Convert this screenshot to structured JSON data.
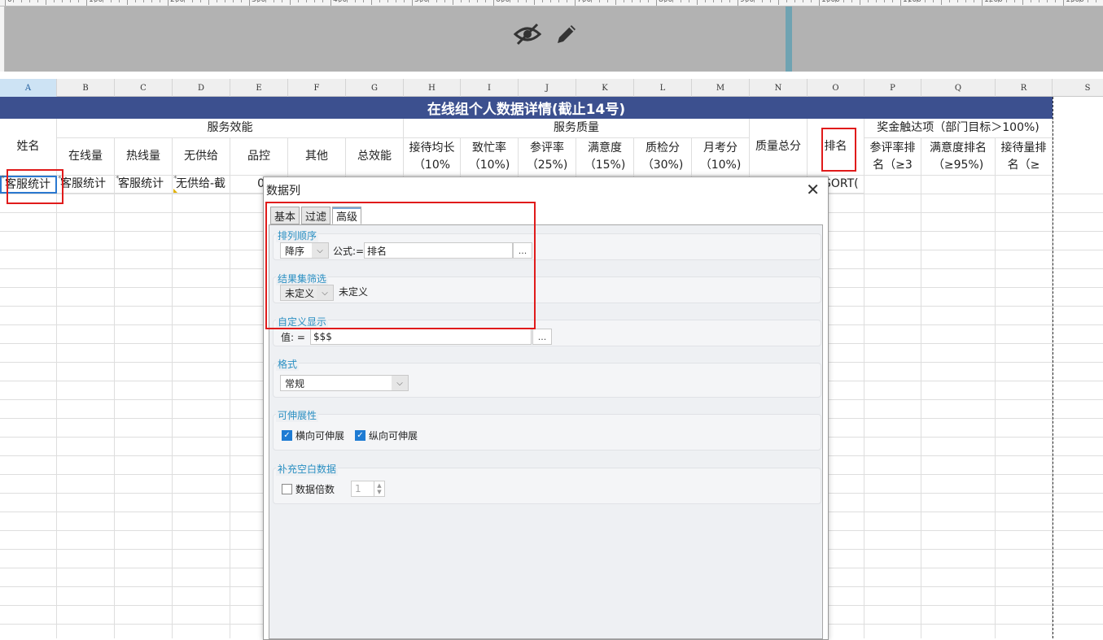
{
  "ruler": {
    "labels": [
      "0",
      "100",
      "200",
      "300",
      "400",
      "500",
      "600",
      "700",
      "800",
      "900",
      "1000",
      "1100",
      "1200",
      "1300"
    ]
  },
  "banner": {
    "icons": [
      "eye-slash-icon",
      "pencil-icon"
    ]
  },
  "columns": [
    "A",
    "B",
    "C",
    "D",
    "E",
    "F",
    "G",
    "H",
    "I",
    "J",
    "K",
    "L",
    "M",
    "N",
    "O",
    "P",
    "Q",
    "R",
    "S"
  ],
  "sheet": {
    "title": "在线组个人数据详情(截止14号)",
    "groups": {
      "name": "姓名",
      "service_efficiency": "服务效能",
      "service_quality": "服务质量",
      "quality_total": "质量总分",
      "ranking": "排名",
      "bonus": "奖金触达项（部门目标＞100%)"
    },
    "headers": {
      "online": "在线量",
      "hotline": "热线量",
      "no_supply": "无供给",
      "quality_ctrl": "品控",
      "other": "其他",
      "total_eff": "总效能",
      "reception": "接待均长（10%",
      "busy": "致忙率（10%)",
      "review": "参评率（25%)",
      "satisfaction": "满意度（15%)",
      "qc_score": "质检分（30%)",
      "monthly": "月考分（10%)",
      "review_rank": "参评率排名（≥3",
      "satisfaction_rank": "满意度排名（≥95%)",
      "reception_rank": "接待量排名（≥"
    },
    "row1": {
      "a": "客服统计",
      "b": "客服统计",
      "c": "客服统计",
      "d": "无供给-截",
      "e": "0",
      "o": "SORT("
    }
  },
  "dialog": {
    "title": "数据列",
    "tabs": [
      "基本",
      "过滤",
      "高级"
    ],
    "active_tab": "高级",
    "sort_group": {
      "label": "排列顺序",
      "order": "降序",
      "formula_label": "公式:=",
      "formula": "排名",
      "more": "..."
    },
    "filter_group": {
      "label": "结果集筛选",
      "value": "未定义",
      "text": "未定义"
    },
    "display_group": {
      "label": "自定义显示",
      "value_label": "值:  =",
      "value": "$$$",
      "more": "..."
    },
    "format_group": {
      "label": "格式",
      "value": "常规"
    },
    "expand_group": {
      "label": "可伸展性",
      "horizontal": "横向可伸展",
      "vertical": "纵向可伸展",
      "horizontal_checked": true,
      "vertical_checked": true
    },
    "fill_group": {
      "label": "补充空白数据",
      "multiple_label": "数据倍数",
      "multiple": "1",
      "checked": false
    }
  },
  "colors": {
    "title_bg": "#3c508f",
    "highlight": "#e01b1b",
    "accent": "#2a8fc2"
  }
}
